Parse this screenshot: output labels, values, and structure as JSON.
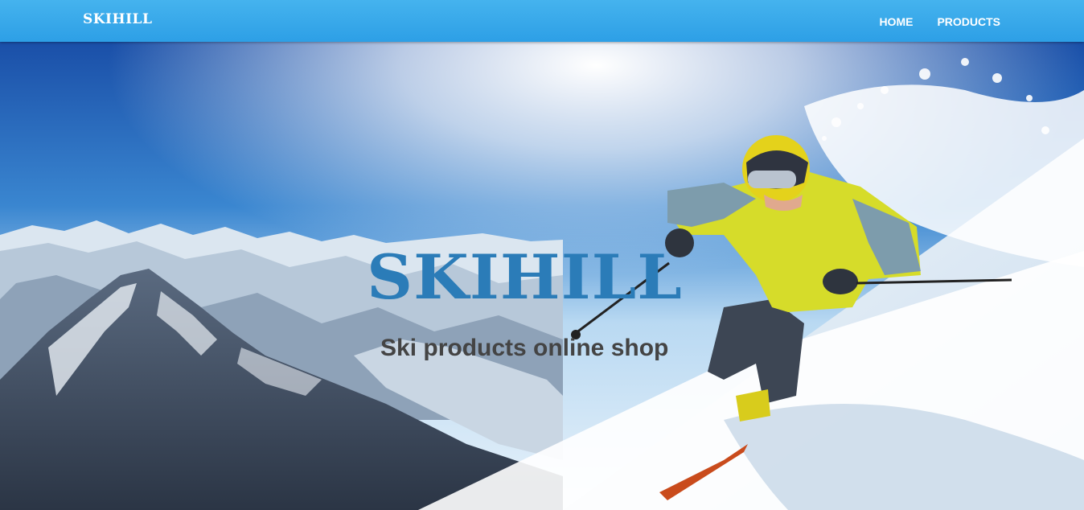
{
  "navbar": {
    "brand": "SKIHILL",
    "links": [
      {
        "label": "HOME"
      },
      {
        "label": "PRODUCTS"
      }
    ]
  },
  "hero": {
    "title": "SKIHILL",
    "subtitle": "Ski products online shop",
    "image": "skier-on-mountain-slope"
  },
  "colors": {
    "navbar": "#2d9fe6",
    "title": "#2b7cb8",
    "subtitle": "#444444"
  }
}
